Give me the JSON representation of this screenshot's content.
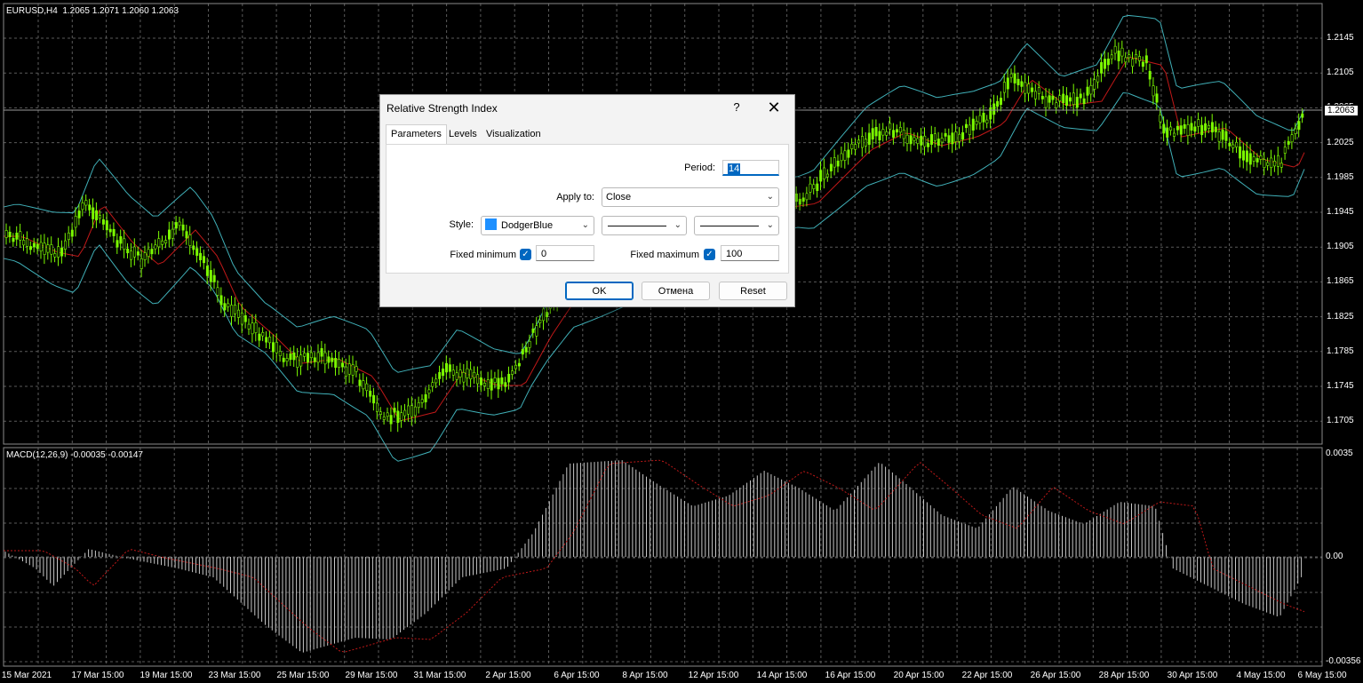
{
  "main_chart": {
    "header": "EURUSD,H4  1.2065 1.2071 1.2060 1.2063",
    "price_scale": [
      "1.2145",
      "1.2105",
      "1.2065",
      "1.2025",
      "1.1985",
      "1.1945",
      "1.1905",
      "1.1865",
      "1.1825",
      "1.1785",
      "1.1745",
      "1.1705"
    ],
    "current_price": "1.2063",
    "colors": {
      "background": "#000000",
      "grid": "#5a5a5a",
      "candle": "#7cfc00",
      "bands": "#40b0b8",
      "ma": "#c01818"
    }
  },
  "macd_panel": {
    "header": "MACD(12,26,9) -0.00035 -0.00147",
    "scale": [
      "0.0035",
      "0.00",
      "-0.00356"
    ],
    "colors": {
      "histogram": "#c8c8c8",
      "signal": "#c01818"
    }
  },
  "time_axis": [
    "15 Mar 2021",
    "17 Mar 15:00",
    "19 Mar 15:00",
    "23 Mar 15:00",
    "25 Mar 15:00",
    "29 Mar 15:00",
    "31 Mar 15:00",
    "2 Apr 15:00",
    "6 Apr 15:00",
    "8 Apr 15:00",
    "12 Apr 15:00",
    "14 Apr 15:00",
    "16 Apr 15:00",
    "20 Apr 15:00",
    "22 Apr 15:00",
    "26 Apr 15:00",
    "28 Apr 15:00",
    "30 Apr 15:00",
    "4 May 15:00",
    "6 May 15:00"
  ],
  "dialog": {
    "title": "Relative Strength Index",
    "help": "?",
    "close": "✕",
    "tabs": [
      "Parameters",
      "Levels",
      "Visualization"
    ],
    "period_label": "Period:",
    "period_value": "14",
    "apply_label": "Apply to:",
    "apply_value": "Close",
    "style_label": "Style:",
    "style_color_name": "DodgerBlue",
    "style_color": "#1e90ff",
    "fixed_min_label": "Fixed minimum",
    "fixed_min_checked": true,
    "fixed_min_value": "0",
    "fixed_max_label": "Fixed maximum",
    "fixed_max_checked": true,
    "fixed_max_value": "100",
    "ok_label": "OK",
    "cancel_label": "Отмена",
    "reset_label": "Reset"
  }
}
